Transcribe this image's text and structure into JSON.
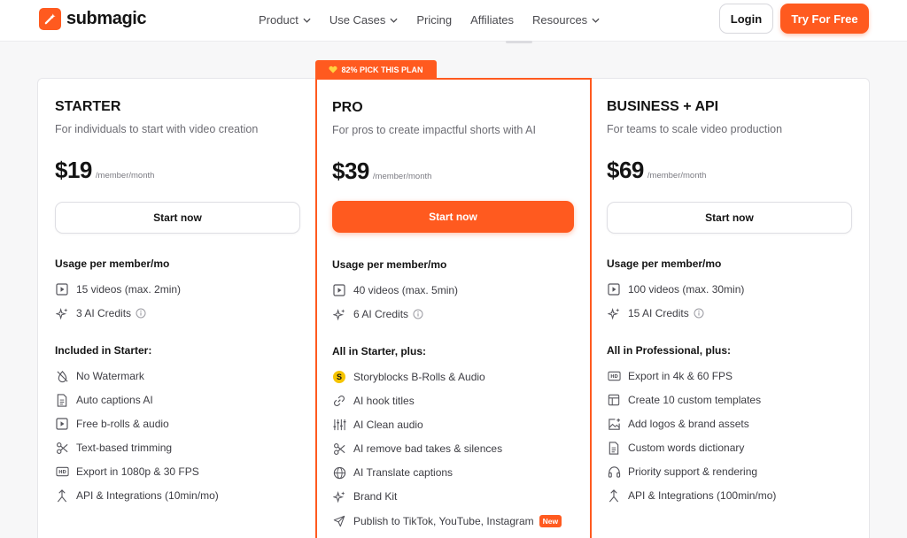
{
  "header": {
    "brand": "submagic",
    "nav": [
      {
        "label": "Product",
        "has_dropdown": true
      },
      {
        "label": "Use Cases",
        "has_dropdown": true
      },
      {
        "label": "Pricing",
        "has_dropdown": false
      },
      {
        "label": "Affiliates",
        "has_dropdown": false
      },
      {
        "label": "Resources",
        "has_dropdown": true
      }
    ],
    "login_label": "Login",
    "try_label": "Try For Free"
  },
  "colors": {
    "accent": "#ff5a1f",
    "text": "#141414",
    "muted": "#6c6c73"
  },
  "plans": [
    {
      "name": "STARTER",
      "description": "For individuals to start with video creation",
      "price": "$19",
      "per": "/member/month",
      "cta": "Start now",
      "usage_title": "Usage per member/mo",
      "usage": [
        {
          "icon": "play-square-icon",
          "text": "15 videos (max. 2min)"
        },
        {
          "icon": "sparkles-icon",
          "text": "3 AI Credits",
          "info": true
        }
      ],
      "included_title": "Included in Starter:",
      "features": [
        {
          "icon": "no-watermark-icon",
          "text": "No Watermark"
        },
        {
          "icon": "document-icon",
          "text": "Auto captions AI"
        },
        {
          "icon": "play-square-icon",
          "text": "Free b-rolls & audio"
        },
        {
          "icon": "scissors-icon",
          "text": "Text-based trimming"
        },
        {
          "icon": "hd-icon",
          "text": "Export in 1080p & 30 FPS"
        },
        {
          "icon": "merge-arrow-icon",
          "text": "API & Integrations (10min/mo)"
        }
      ]
    },
    {
      "name": "PRO",
      "badge": "82% PICK THIS PLAN",
      "description": "For pros to create impactful shorts with AI",
      "price": "$39",
      "per": "/member/month",
      "cta": "Start now",
      "usage_title": "Usage per member/mo",
      "usage": [
        {
          "icon": "play-square-icon",
          "text": "40 videos (max. 5min)"
        },
        {
          "icon": "sparkles-icon",
          "text": "6 AI Credits",
          "info": true
        }
      ],
      "included_title": "All in Starter, plus:",
      "features": [
        {
          "icon": "storyblocks-logo-icon",
          "text": "Storyblocks B-Rolls & Audio"
        },
        {
          "icon": "link-icon",
          "text": "AI hook titles"
        },
        {
          "icon": "equalizer-icon",
          "text": "AI Clean audio"
        },
        {
          "icon": "scissors-icon",
          "text": "AI remove bad takes & silences"
        },
        {
          "icon": "globe-icon",
          "text": "AI Translate captions"
        },
        {
          "icon": "sparkles-icon",
          "text": "Brand Kit"
        },
        {
          "icon": "send-icon",
          "text": "Publish to TikTok, YouTube, Instagram",
          "tag": "New"
        }
      ]
    },
    {
      "name": "BUSINESS + API",
      "description": "For teams to scale video production",
      "price": "$69",
      "per": "/member/month",
      "cta": "Start now",
      "usage_title": "Usage per member/mo",
      "usage": [
        {
          "icon": "play-square-icon",
          "text": "100 videos (max. 30min)"
        },
        {
          "icon": "sparkles-icon",
          "text": "15 AI Credits",
          "info": true
        }
      ],
      "included_title": "All in Professional, plus:",
      "features": [
        {
          "icon": "hd-icon",
          "text": "Export in 4k & 60 FPS"
        },
        {
          "icon": "template-icon",
          "text": "Create 10 custom templates"
        },
        {
          "icon": "image-plus-icon",
          "text": "Add logos & brand assets"
        },
        {
          "icon": "document-icon",
          "text": "Custom words dictionary"
        },
        {
          "icon": "headphones-icon",
          "text": "Priority support & rendering"
        },
        {
          "icon": "merge-arrow-icon",
          "text": "API & Integrations (100min/mo)"
        }
      ]
    }
  ]
}
